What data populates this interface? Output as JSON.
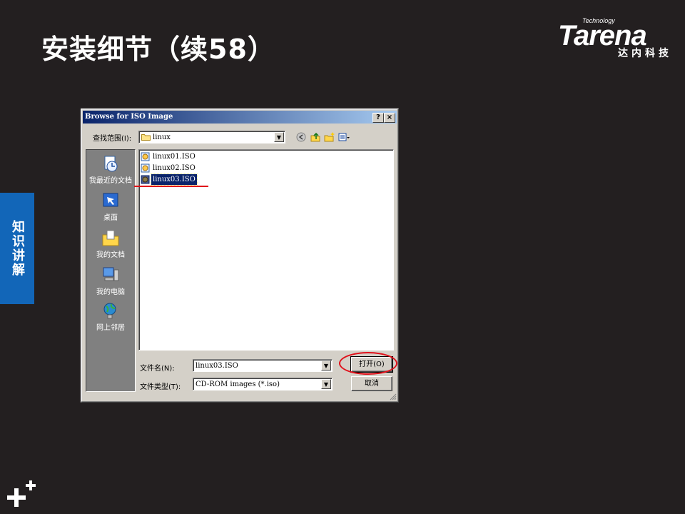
{
  "slide": {
    "title": "安装细节（续58）",
    "side_tab": "知识讲解"
  },
  "logo": {
    "tagline": "Technology",
    "brand": "Tarena",
    "sub": "达内科技"
  },
  "dialog": {
    "title": "Browse for ISO Image",
    "help_button": "?",
    "close_button": "×",
    "look_in_label": "查找范围(I):",
    "look_in_value": "linux",
    "places": [
      {
        "label": "我最近的文档",
        "icon": "recent-documents-icon"
      },
      {
        "label": "桌面",
        "icon": "desktop-icon"
      },
      {
        "label": "我的文档",
        "icon": "my-documents-icon"
      },
      {
        "label": "我的电脑",
        "icon": "my-computer-icon"
      },
      {
        "label": "网上邻居",
        "icon": "network-icon"
      }
    ],
    "files": [
      {
        "name": "linux01.ISO",
        "selected": false
      },
      {
        "name": "linux02.ISO",
        "selected": false
      },
      {
        "name": "linux03.ISO",
        "selected": true
      }
    ],
    "filename_label": "文件名(N):",
    "filename_value": "linux03.ISO",
    "filetype_label": "文件类型(T):",
    "filetype_value": "CD-ROM images (*.iso)",
    "open_button": "打开(O)",
    "cancel_button": "取消"
  },
  "colors": {
    "background": "#231f20",
    "side_tab": "#1266b8",
    "annotation_red": "#e0101a",
    "selection": "#0a246a"
  }
}
